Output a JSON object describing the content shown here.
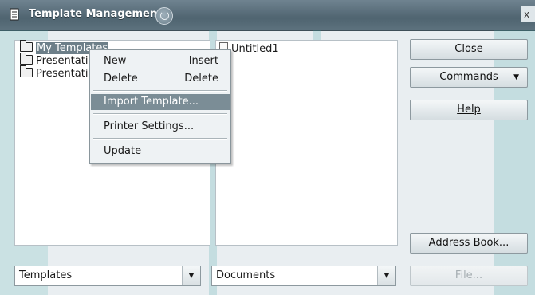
{
  "window": {
    "title": "Template Management",
    "close_glyph": "x"
  },
  "left_panel": {
    "items": [
      {
        "label": "My Templates",
        "selected": true
      },
      {
        "label": "Presentati"
      },
      {
        "label": "Presentati"
      }
    ]
  },
  "right_panel": {
    "items": [
      {
        "label": "Untitled1",
        "icon": "document-icon"
      }
    ]
  },
  "context_menu": {
    "new": {
      "label": "New",
      "shortcut": "Insert"
    },
    "delete": {
      "label": "Delete",
      "shortcut": "Delete"
    },
    "import": {
      "label": "Import Template..."
    },
    "printer": {
      "label": "Printer Settings..."
    },
    "update": {
      "label": "Update"
    }
  },
  "buttons": {
    "close": "Close",
    "commands": "Commands",
    "help": "Help",
    "address_book": "Address Book...",
    "file": "File..."
  },
  "combos": {
    "left": {
      "value": "Templates"
    },
    "right": {
      "value": "Documents"
    }
  },
  "colors": {
    "selection": "#6d7f89",
    "menu_highlight": "#7b8d96",
    "watermark": "#3fa5a6"
  }
}
